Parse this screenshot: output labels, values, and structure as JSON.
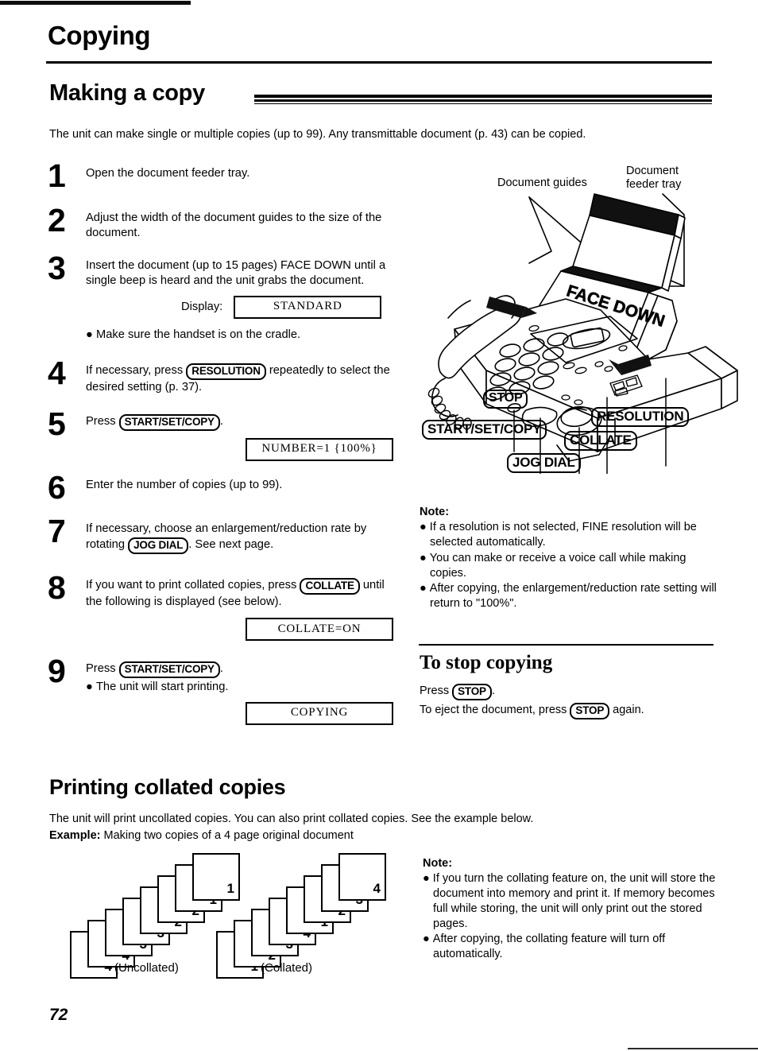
{
  "chapter": {
    "title": "Copying"
  },
  "section": {
    "title": "Making a copy"
  },
  "intro": "The unit can make single or multiple copies (up to 99). Any transmittable document (p. 43) can be copied.",
  "steps": [
    {
      "number": "1",
      "lines": [
        "Open the document feeder tray."
      ]
    },
    {
      "number": "2",
      "lines": [
        "Adjust the width of the document guides to the size of the document."
      ]
    },
    {
      "number": "3",
      "lines": [
        "Insert the document (up to 15 pages) FACE DOWN until a single beep is heard and the unit grabs the document."
      ],
      "display_label": "Display:",
      "display_value": "STANDARD",
      "bullet": "Make sure the handset is on the cradle."
    },
    {
      "number": "4",
      "pre": "If necessary, press",
      "key": "RESOLUTION",
      "post": "repeatedly to select the desired setting (p. 37)."
    },
    {
      "number": "5",
      "pre": "Press",
      "key": "START/SET/COPY",
      "post": ".",
      "display_value": "NUMBER=1  {100%}"
    },
    {
      "number": "6",
      "lines": [
        "Enter the number of copies (up to 99)."
      ]
    },
    {
      "number": "7",
      "pre": "If necessary, choose an enlargement/reduction rate by rotating",
      "key": "JOG DIAL",
      "post": ". See next page."
    },
    {
      "number": "8",
      "pre": "If you want to print collated copies, press",
      "key": "COLLATE",
      "post": "until the following is displayed (see below).",
      "display_value": "COLLATE=ON"
    },
    {
      "number": "9",
      "pre": "Press",
      "key": "START/SET/COPY",
      "post": ".",
      "bullet": "The unit will start printing.",
      "display_value": "COPYING"
    }
  ],
  "illustration": {
    "callouts": [
      {
        "name": "document-guides",
        "text": "Document guides"
      },
      {
        "name": "document-feeder-tray",
        "text": "Document\nfeeder tray"
      },
      {
        "name": "face-down",
        "text": "FACE DOWN"
      }
    ],
    "key_labels": [
      {
        "name": "stop",
        "text": "STOP"
      },
      {
        "name": "start-set-copy",
        "text": "START/SET/COPY"
      },
      {
        "name": "resolution",
        "text": "RESOLUTION"
      },
      {
        "name": "collate",
        "text": "COLLATE"
      },
      {
        "name": "jog-dial",
        "text": "JOG DIAL"
      }
    ]
  },
  "note_copying": {
    "title": "Note:",
    "items": [
      "If a resolution is not selected, FINE resolution will be selected automatically.",
      "You can make or receive a voice call while making copies.",
      "After copying, the enlargement/reduction rate setting will return to \"100%\"."
    ]
  },
  "stop_copying": {
    "heading": "To stop copying",
    "line1_pre": "Press",
    "line1_key": "STOP",
    "line1_post": ".",
    "line2_pre": "To eject the document, press",
    "line2_key": "STOP",
    "line2_post": "again."
  },
  "collated": {
    "heading": "Printing collated copies",
    "paragraph": "The unit will print uncollated copies. You can also print collated copies. See the example below.",
    "example_label": "Example:",
    "example_text": "Making two copies of a 4 page original document",
    "stacks": [
      {
        "name": "uncollated",
        "caption": "(Uncollated)",
        "sheets": [
          "4",
          "4",
          "3",
          "3",
          "2",
          "2",
          "1",
          "1"
        ]
      },
      {
        "name": "collated",
        "caption": "(Collated)",
        "sheets": [
          "1",
          "2",
          "3",
          "4",
          "1",
          "2",
          "3",
          "4"
        ]
      }
    ]
  },
  "note_collated": {
    "title": "Note:",
    "items": [
      "If you turn the collating feature on, the unit will store the document into memory and print it. If memory becomes full while storing, the unit will only print out the stored pages.",
      "After copying, the collating feature will turn off automatically."
    ]
  },
  "footer": {
    "page_number": "72"
  }
}
